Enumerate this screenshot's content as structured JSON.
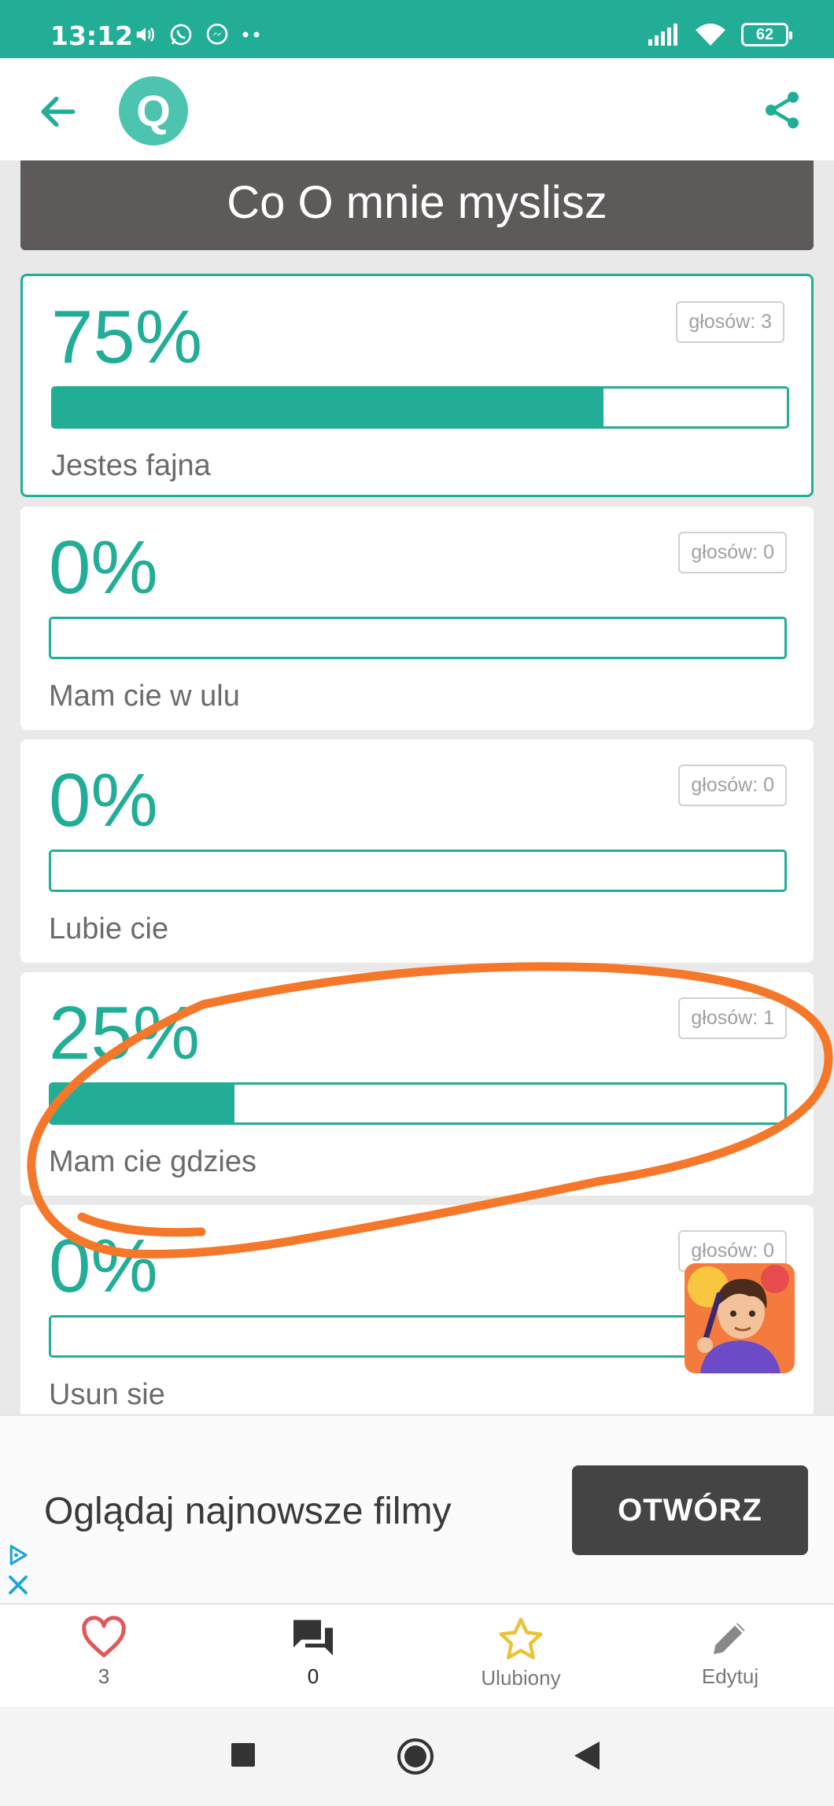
{
  "status_bar": {
    "time": "13:12",
    "battery": "62",
    "left_icons": [
      "volume-icon",
      "whatsapp-icon",
      "messenger-icon",
      "more-dots-icon"
    ],
    "right_icons": [
      "signal-icon",
      "wifi-icon",
      "battery-icon"
    ]
  },
  "app_bar": {
    "logo_letter": "Q",
    "icons": [
      "arrow-left-icon",
      "share-icon"
    ]
  },
  "quiz": {
    "title": "Co O mnie myslisz",
    "options": [
      {
        "percent": "75%",
        "fraction": 0.75,
        "votes": "głosów: 3",
        "label": "Jestes fajna",
        "selected": true
      },
      {
        "percent": "0%",
        "fraction": 0.0,
        "votes": "głosów: 0",
        "label": "Mam cie w ulu",
        "selected": false
      },
      {
        "percent": "0%",
        "fraction": 0.0,
        "votes": "głosów: 0",
        "label": "Lubie cie",
        "selected": false
      },
      {
        "percent": "25%",
        "fraction": 0.25,
        "votes": "głosów: 1",
        "label": "Mam cie gdzies",
        "selected": false
      },
      {
        "percent": "0%",
        "fraction": 0.0,
        "votes": "głosów: 0",
        "label": "Usun sie",
        "selected": false
      }
    ]
  },
  "ad": {
    "text": "Oglądaj najnowsze filmy",
    "button": "OTWÓRZ"
  },
  "bottom_nav": {
    "likes": "3",
    "comments": "0",
    "favorite": "Ulubiony",
    "edit": "Edytuj"
  },
  "colors": {
    "accent": "#22ad97",
    "banner": "#5d5a59",
    "annotation": "#f5782a",
    "heart": "#e0585b",
    "star": "#e9c33a"
  }
}
